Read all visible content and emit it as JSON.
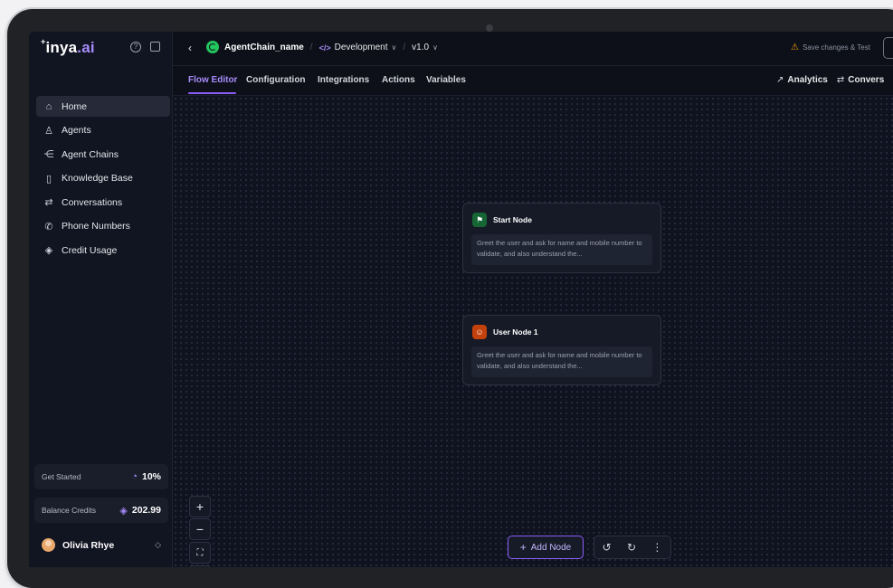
{
  "brand": {
    "logo_text": "inya",
    "logo_tld": ".ai"
  },
  "sidebar": {
    "items": [
      {
        "label": "Home",
        "icon": "home-icon",
        "glyph": "⌂"
      },
      {
        "label": "Agents",
        "icon": "agents-icon",
        "glyph": "♙"
      },
      {
        "label": "Agent Chains",
        "icon": "agent-chains-icon",
        "glyph": "⋲"
      },
      {
        "label": "Knowledge Base",
        "icon": "book-icon",
        "glyph": "▯"
      },
      {
        "label": "Conversations",
        "icon": "swap-icon",
        "glyph": "⇄"
      },
      {
        "label": "Phone Numbers",
        "icon": "phone-icon",
        "glyph": "✆"
      },
      {
        "label": "Credit Usage",
        "icon": "coin-icon",
        "glyph": "◈"
      }
    ],
    "get_started": {
      "label": "Get Started",
      "value": "10%"
    },
    "balance": {
      "label": "Balance Credits",
      "value": "202.99"
    },
    "user": {
      "name": "Olivia Rhye"
    }
  },
  "topbar": {
    "chain_name": "AgentChain_name",
    "environment": "Development",
    "version": "v1.0",
    "warning": "Save changes & Test"
  },
  "tabs": [
    {
      "label": "Flow Editor",
      "active": true
    },
    {
      "label": "Configuration"
    },
    {
      "label": "Integrations"
    },
    {
      "label": "Actions"
    },
    {
      "label": "Variables"
    }
  ],
  "right_links": {
    "analytics": "Analytics",
    "conversations": "Convers"
  },
  "nodes": [
    {
      "title": "Start Node",
      "description": "Greet the user and ask for name and mobile number to validate, and also understand the...",
      "color": "#16a34a"
    },
    {
      "title": "User Node 1",
      "description": "Greet the user and ask for name and mobile number to validate, and also understand the...",
      "color": "#ea580c"
    }
  ],
  "canvas": {
    "add_node_label": "Add Node"
  },
  "colors": {
    "accent": "#8b5cf6",
    "background": "#0d1018"
  }
}
